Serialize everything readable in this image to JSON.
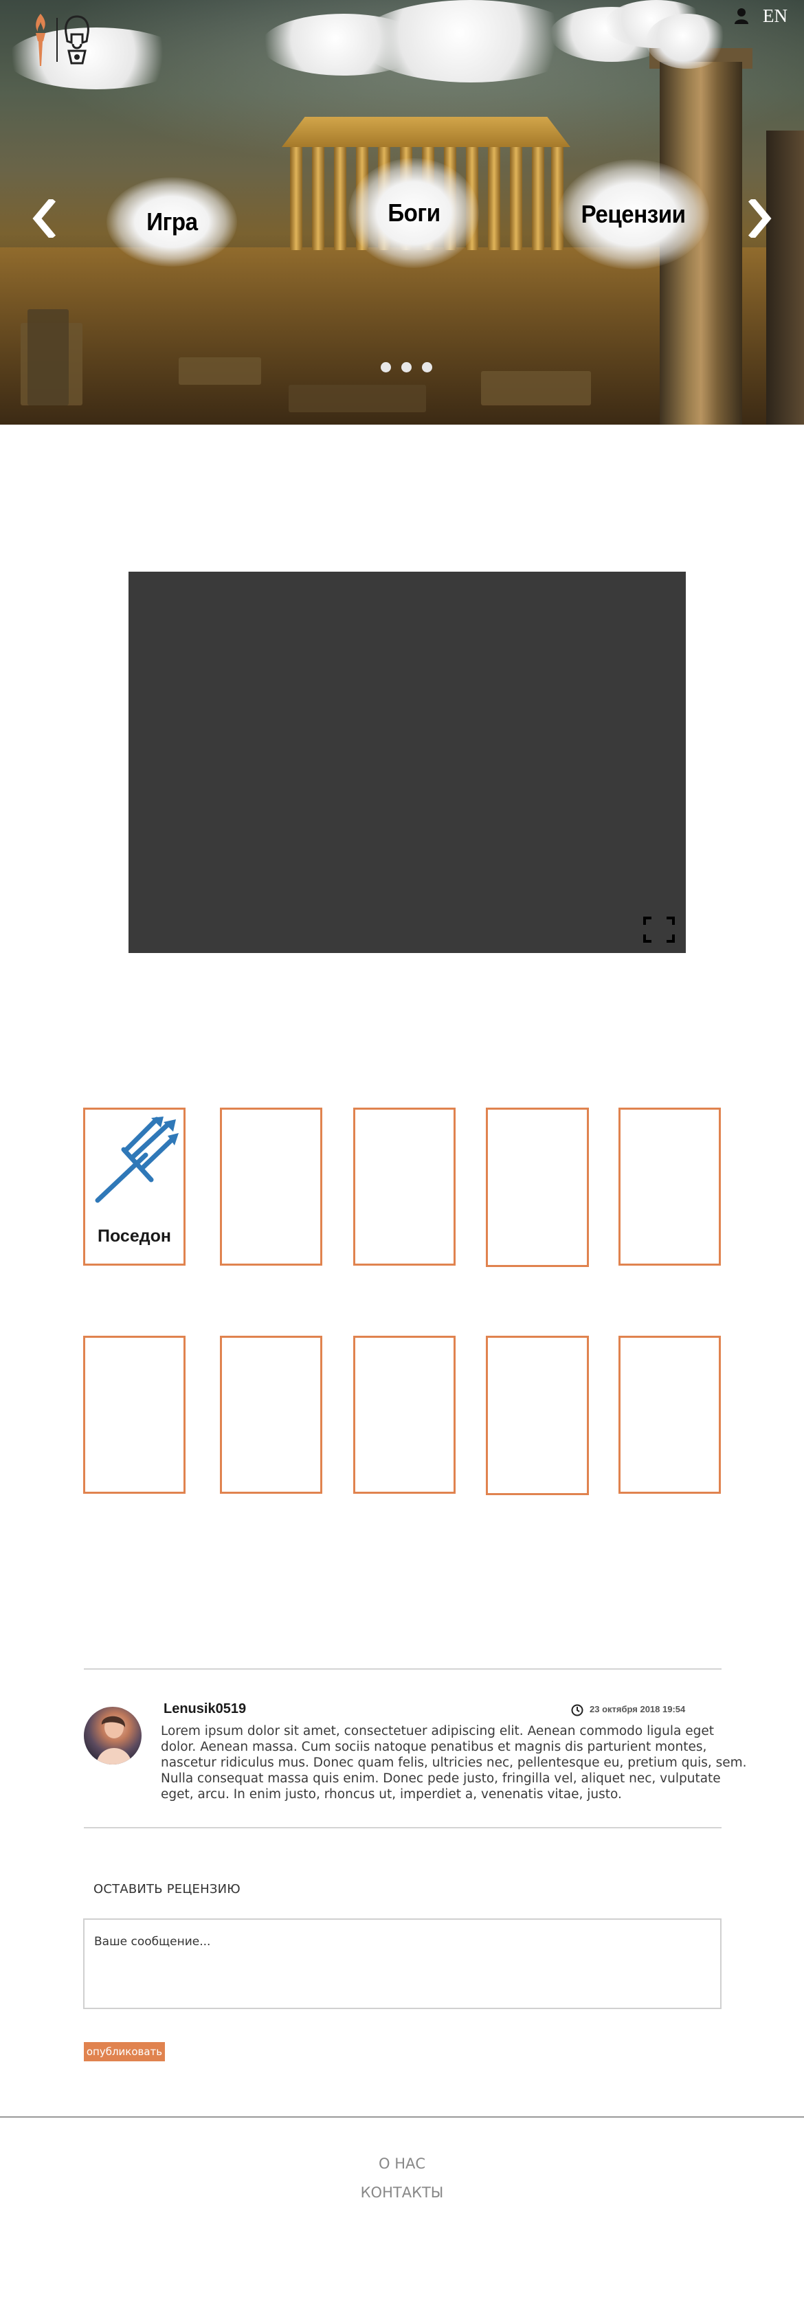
{
  "header": {
    "lang_label": "EN",
    "nav": [
      {
        "label": "Игра"
      },
      {
        "label": "Боги"
      },
      {
        "label": "Рецензии"
      }
    ],
    "slider": {
      "slide_count": 3,
      "active_index": 0
    }
  },
  "gods": {
    "cards": [
      {
        "name": "Поседон",
        "icon": "trident-icon"
      },
      {
        "name": ""
      },
      {
        "name": ""
      },
      {
        "name": ""
      },
      {
        "name": ""
      },
      {
        "name": ""
      },
      {
        "name": ""
      },
      {
        "name": ""
      },
      {
        "name": ""
      },
      {
        "name": ""
      }
    ]
  },
  "reviews": {
    "items": [
      {
        "user": "Lenusik0519",
        "date": "23 октября 2018 19:54",
        "text": "Lorem ipsum dolor sit amet, consectetuer adipiscing elit. Aenean commodo ligula eget dolor. Aenean massa. Cum sociis natoque penatibus et magnis dis parturient montes, nascetur ridiculus mus. Donec quam felis, ultricies nec, pellentesque eu, pretium quis, sem. Nulla consequat massa quis enim. Donec pede justo, fringilla vel, aliquet nec, vulputate eget, arcu. In enim justo, rhoncus ut, imperdiet a, venenatis vitae, justo."
      }
    ],
    "leave_label": "ОСТАВИТЬ РЕЦЕНЗИЮ",
    "message_placeholder": "Ваше сообщение...",
    "publish_label": "опубликовать"
  },
  "footer": {
    "about_label": "О НАС",
    "contacts_label": "КОНТАКТЫ"
  },
  "colors": {
    "accent": "#e0834f",
    "video_bg": "#3a3a3a",
    "trident": "#2f78b8"
  }
}
